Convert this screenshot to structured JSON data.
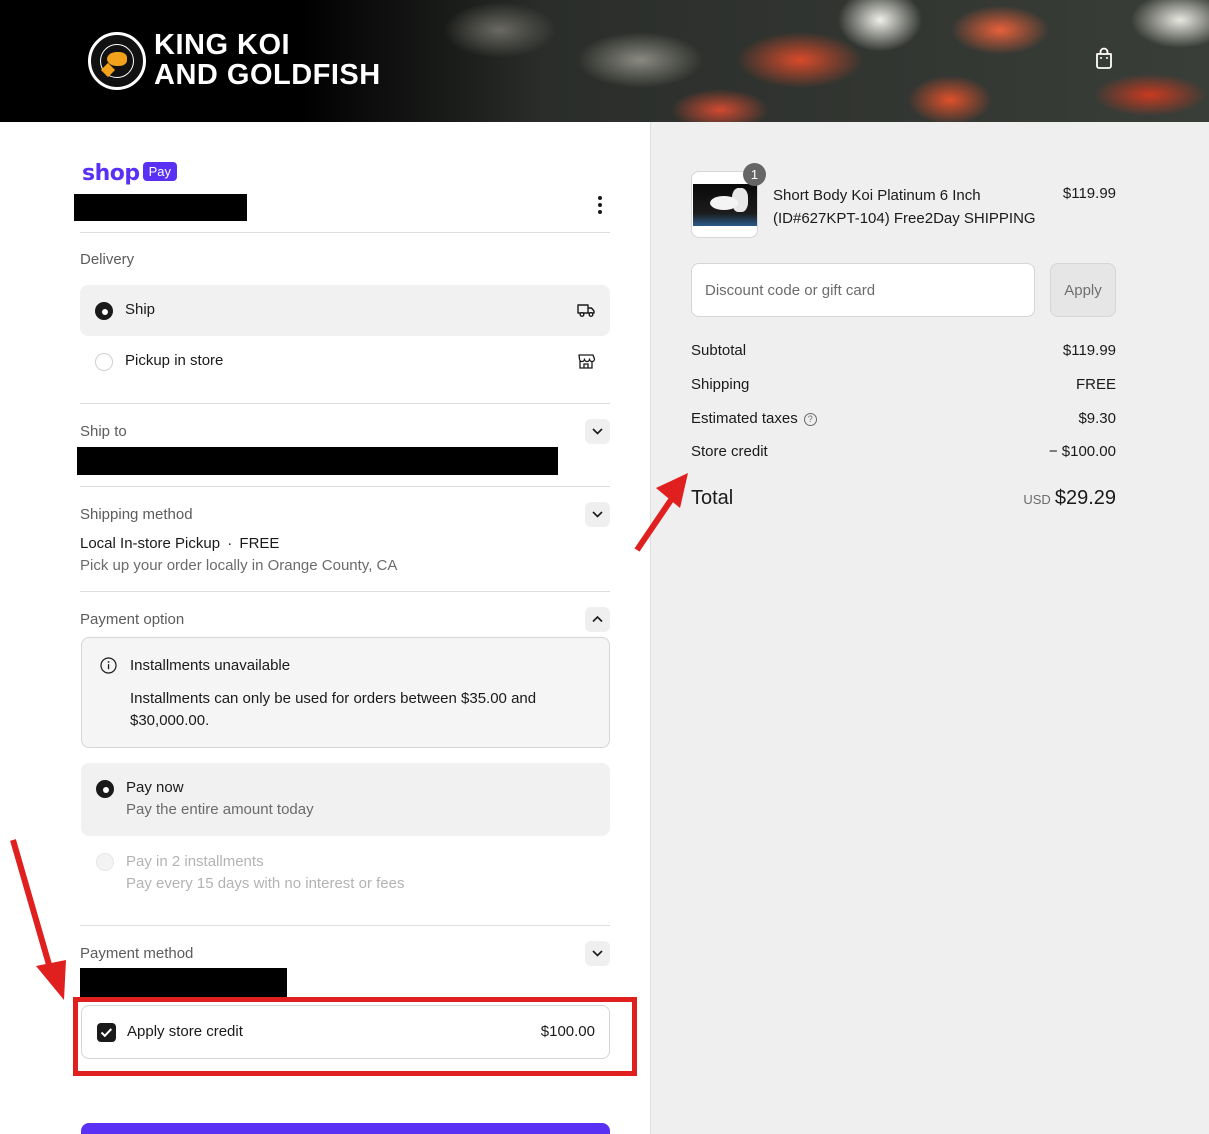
{
  "header": {
    "logo_line1": "KING KOI",
    "logo_line2": "AND GOLDFISH",
    "seal_text": "KING KOI AND GOLDFISH"
  },
  "shop_pay": {
    "shop": "shop",
    "pay": "Pay"
  },
  "delivery": {
    "label": "Delivery",
    "options": [
      {
        "label": "Ship",
        "selected": true,
        "icon": "truck-icon"
      },
      {
        "label": "Pickup in store",
        "selected": false,
        "icon": "store-icon"
      }
    ]
  },
  "ship_to": {
    "label": "Ship to"
  },
  "shipping_method": {
    "label": "Shipping method",
    "name": "Local In-store Pickup",
    "separator": "·",
    "price": "FREE",
    "description": "Pick up your order locally in Orange County, CA"
  },
  "payment_option": {
    "label": "Payment option",
    "notice_title": "Installments unavailable",
    "notice_body": "Installments can only be used for orders between $35.00 and $30,000.00.",
    "options": [
      {
        "label": "Pay now",
        "sub": "Pay the entire amount today",
        "selected": true,
        "disabled": false
      },
      {
        "label": "Pay in 2 installments",
        "sub": "Pay every 15 days with no interest or fees",
        "selected": false,
        "disabled": true
      }
    ]
  },
  "payment_method": {
    "label": "Payment method",
    "store_credit_label": "Apply store credit",
    "store_credit_amount": "$100.00",
    "store_credit_checked": true
  },
  "summary": {
    "item": {
      "quantity": "1",
      "title_line1": "Short Body Koi Platinum 6 Inch",
      "title_line2": "(ID#627KPT-104) Free2Day SHIPPING",
      "price": "$119.99"
    },
    "discount_placeholder": "Discount code or gift card",
    "apply_label": "Apply",
    "subtotal_label": "Subtotal",
    "subtotal_value": "$119.99",
    "shipping_label": "Shipping",
    "shipping_value": "FREE",
    "taxes_label": "Estimated taxes",
    "taxes_value": "$9.30",
    "store_credit_label": "Store credit",
    "store_credit_value": "− $100.00",
    "total_label": "Total",
    "total_currency": "USD",
    "total_value": "$29.29"
  },
  "colors": {
    "brand": "#5a31f4",
    "annotation_red": "#e01f1f",
    "summary_bg": "#efefef"
  }
}
